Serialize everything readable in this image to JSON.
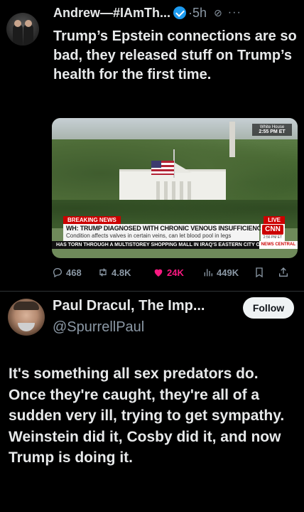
{
  "post1": {
    "display_name": "Andrew—#IAmTh...",
    "time": "5h",
    "dot": "·",
    "text": "Trump’s Epstein connections are so bad, they released stuff on Trump’s health for the first time.",
    "media": {
      "clock_location": "White House",
      "clock_time": "2:55 PM ET",
      "breaking_label": "BREAKING NEWS",
      "live_label": "LIVE",
      "headline": "WH: TRUMP DIAGNOSED WITH CHRONIC VENOUS INSUFFICIENCY",
      "subline": "Condition affects valves in certain veins, can let blood pool in legs",
      "network": "CNN",
      "cnn_time": "2:56 PM ET",
      "ticker": "HAS TORN THROUGH A MULTISTOREY SHOPPING MALL IN IRAQ'S EASTERN CITY OF KU",
      "ticker_tag": "NEWS CENTRAL"
    },
    "actions": {
      "replies": "468",
      "reposts": "4.8K",
      "likes": "24K",
      "views": "449K"
    },
    "colors": {
      "like": "#f91880",
      "verified": "#1d9bf0"
    }
  },
  "post2": {
    "display_name": "Paul Dracul, The Imp...",
    "handle": "@SpurrellPaul",
    "follow_label": "Follow",
    "text": "It's something all sex predators do. Once they're caught, they're all of a sudden very ill, trying to get sympathy. Weinstein did it, Cosby did it, and now Trump is doing it."
  }
}
